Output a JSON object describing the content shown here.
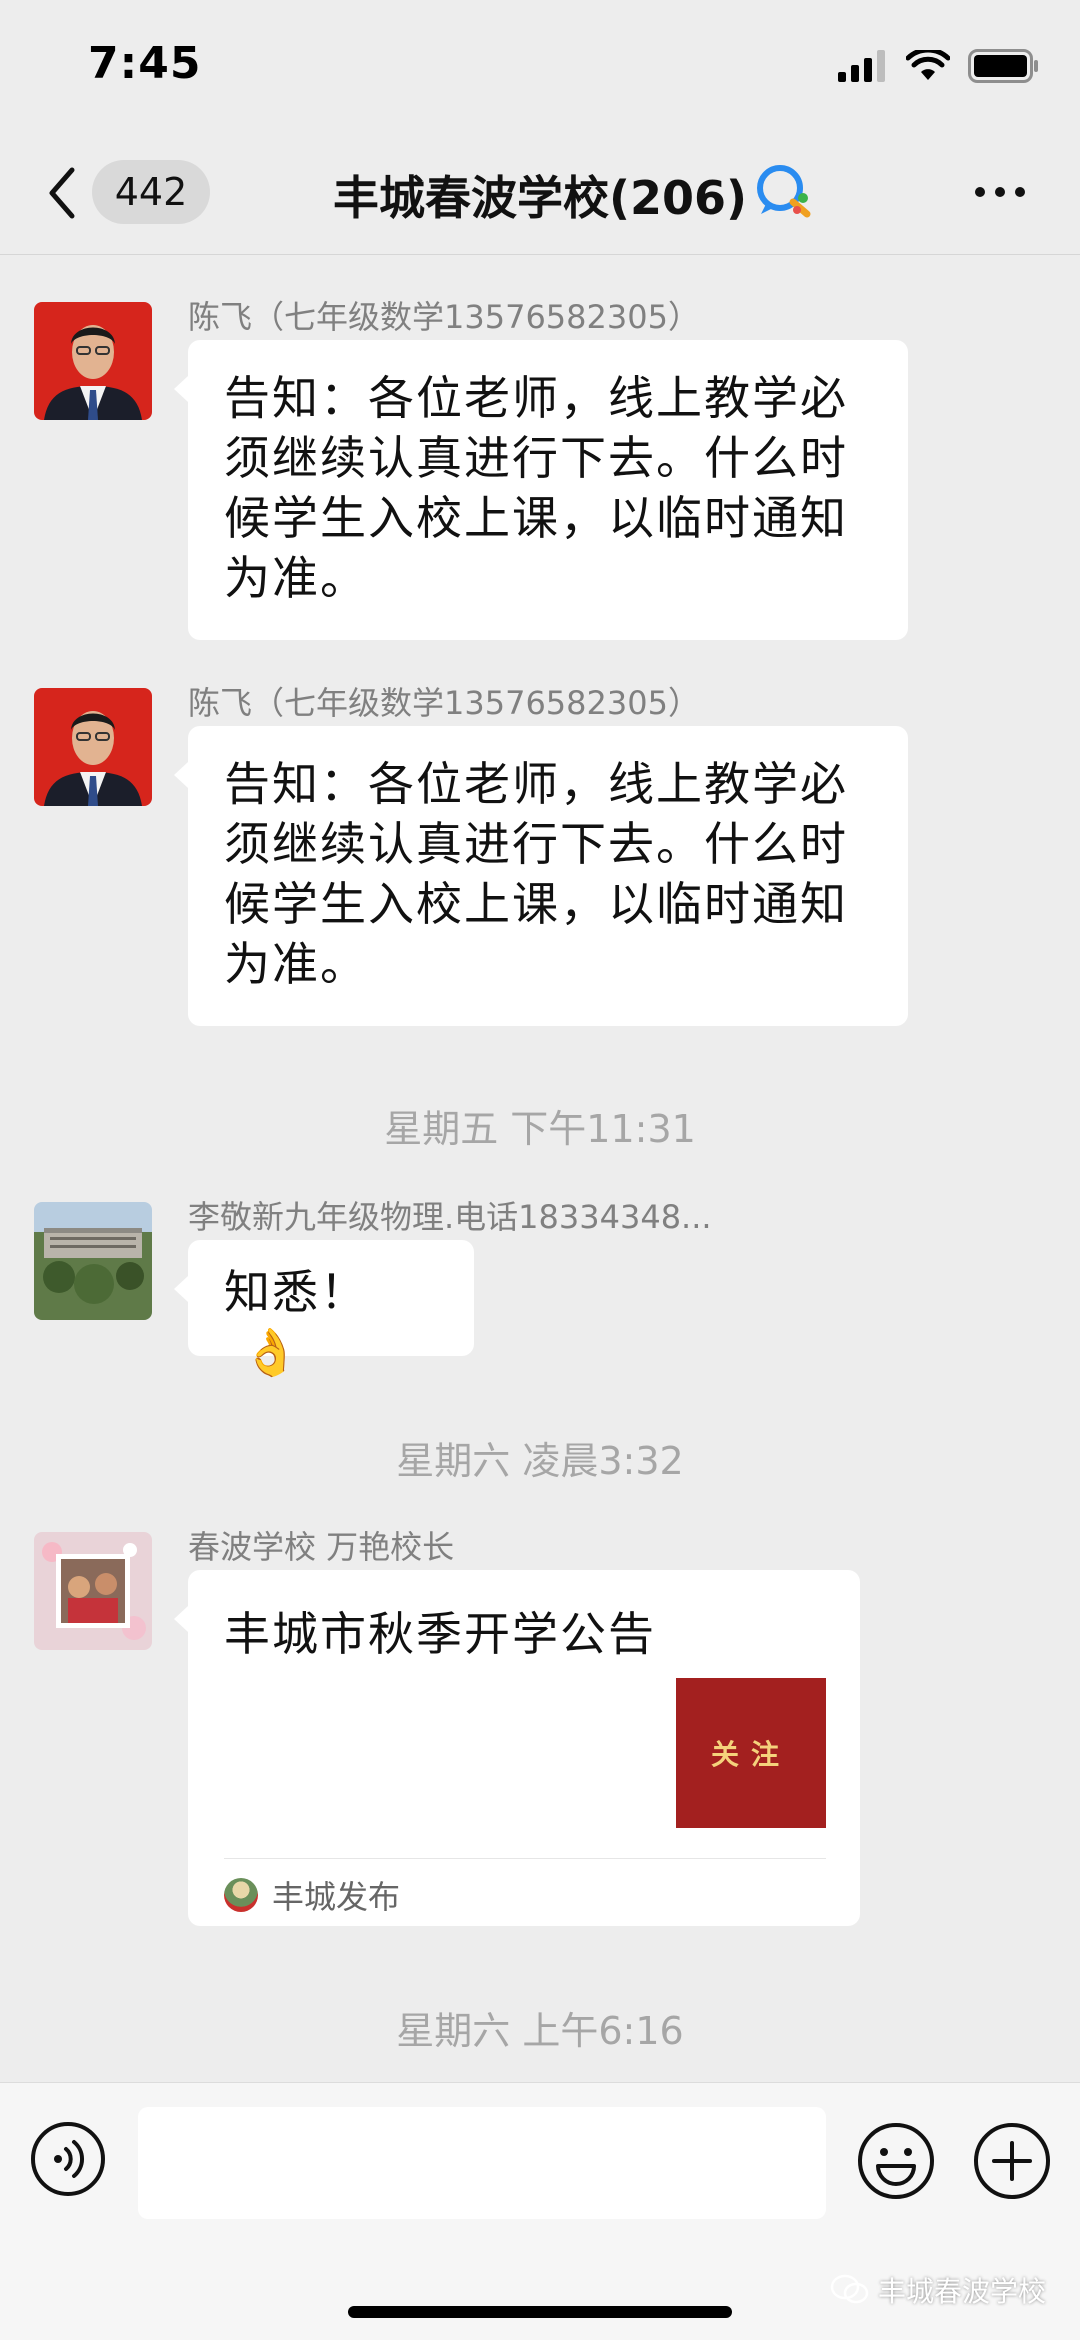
{
  "status_bar": {
    "time": "7:45"
  },
  "header": {
    "unread_count": "442",
    "title": "丰城春波学校(206)"
  },
  "messages": [
    {
      "sender": "陈飞（七年级数学13576582305）",
      "text": "告知：各位老师，线上教学必须继续认真进行下去。什么时候学生入校上课，以临时通知为准。"
    },
    {
      "sender": "陈飞（七年级数学13576582305）",
      "text": "告知：各位老师，线上教学必须继续认真进行下去。什么时候学生入校上课，以临时通知为准。"
    },
    {
      "sender": "李敬新九年级物理.电话18334348...",
      "text": "知悉！",
      "emoji": "👌"
    },
    {
      "sender": "春波学校 万艳校长",
      "card_title": "丰城市秋季开学公告",
      "card_thumb_text": "关注",
      "card_source": "丰城发布"
    }
  ],
  "timestamps": [
    "星期五 下午11:31",
    "星期六 凌晨3:32",
    "星期六 上午6:16"
  ],
  "input": {
    "value": ""
  },
  "watermark": "丰城春波学校",
  "colors": {
    "background": "#ededed",
    "bubble": "#ffffff",
    "card_thumb": "#a3201f",
    "timestamp": "#a6a6a6"
  },
  "icons": [
    "back-arrow-icon",
    "search-chat-icon",
    "more-dots-icon",
    "voice-icon",
    "emoji-icon",
    "plus-icon",
    "signal-icon",
    "wifi-icon",
    "battery-icon",
    "wechat-icon"
  ]
}
